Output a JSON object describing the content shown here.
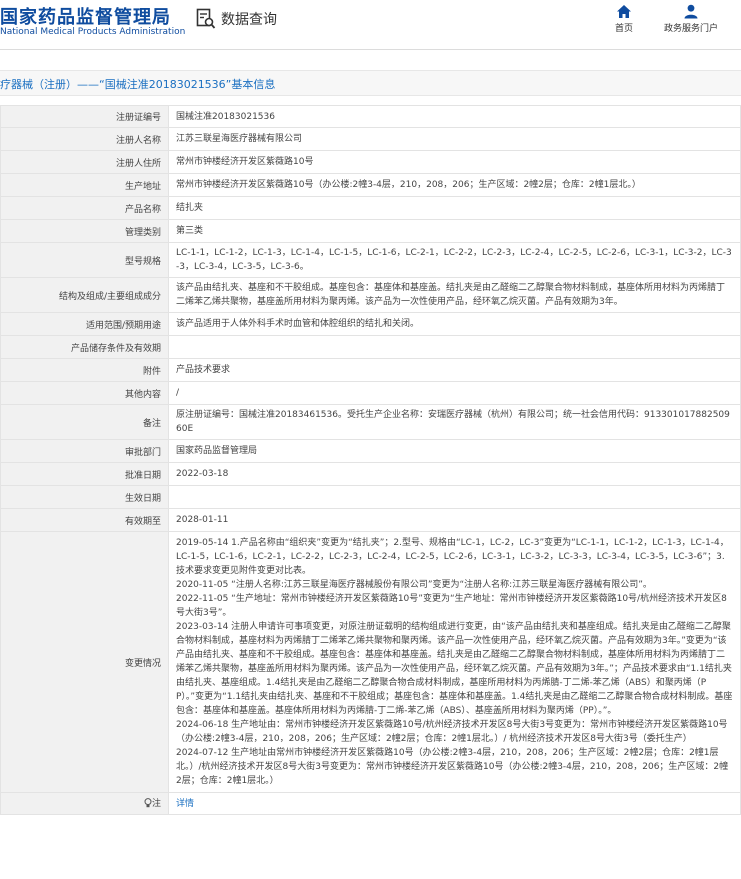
{
  "header": {
    "logo_cn": "国家药品监督管理局",
    "logo_en": "National Medical Products Administration",
    "search_label": "数据查询",
    "nav": [
      {
        "label": "首页",
        "icon": "home-icon"
      },
      {
        "label": "政务服务门户",
        "icon": "user-icon"
      }
    ]
  },
  "breadcrumb_title": "疗器械（注册）——“国械注准20183021536”基本信息",
  "rows": [
    {
      "label": "注册证编号",
      "value": "国械注准20183021536"
    },
    {
      "label": "注册人名称",
      "value": "江苏三联星海医疗器械有限公司"
    },
    {
      "label": "注册人住所",
      "value": "常州市钟楼经济开发区紫薇路10号"
    },
    {
      "label": "生产地址",
      "value": "常州市钟楼经济开发区紫薇路10号（办公楼:2幢3-4层，210，208，206；生产区域：2幢2层；仓库：2幢1层北。）"
    },
    {
      "label": "产品名称",
      "value": "结扎夹"
    },
    {
      "label": "管理类别",
      "value": "第三类"
    },
    {
      "label": "型号规格",
      "value": "LC-1-1，LC-1-2，LC-1-3，LC-1-4，LC-1-5，LC-1-6，LC-2-1，LC-2-2，LC-2-3，LC-2-4，LC-2-5，LC-2-6，LC-3-1，LC-3-2，LC-3-3，LC-3-4，LC-3-5，LC-3-6。"
    },
    {
      "label": "结构及组成/主要组成成分",
      "value": "该产品由结扎夹、基座和不干胶组成。基座包含：基座体和基座盖。结扎夹是由乙醛缩二乙醇聚合物材料制成，基座体所用材料为丙烯腈丁二烯苯乙烯共聚物，基座盖所用材料为聚丙烯。该产品为一次性使用产品，经环氧乙烷灭菌。产品有效期为3年。"
    },
    {
      "label": "适用范围/预期用途",
      "value": "该产品适用于人体外科手术时血管和体腔组织的结扎和关闭。"
    },
    {
      "label": "产品储存条件及有效期",
      "value": ""
    },
    {
      "label": "附件",
      "value": "产品技术要求"
    },
    {
      "label": "其他内容",
      "value": "/"
    },
    {
      "label": "备注",
      "value": "原注册证编号：国械注准20183461536。受托生产企业名称：安瑞医疗器械（杭州）有限公司；统一社会信用代码：91330101788250960E"
    },
    {
      "label": "审批部门",
      "value": "国家药品监督管理局"
    },
    {
      "label": "批准日期",
      "value": "2022-03-18"
    },
    {
      "label": "生效日期",
      "value": ""
    },
    {
      "label": "有效期至",
      "value": "2028-01-11"
    }
  ],
  "changes": {
    "label": "变更情况",
    "entries": [
      "2019-05-14 1.产品名称由“组织夹”变更为“结扎夹”；2.型号、规格由“LC-1，LC-2，LC-3”变更为“LC-1-1，LC-1-2，LC-1-3，LC-1-4，LC-1-5，LC-1-6，LC-2-1，LC-2-2，LC-2-3，LC-2-4，LC-2-5，LC-2-6，LC-3-1，LC-3-2，LC-3-3，LC-3-4，LC-3-5，LC-3-6”；3.技术要求变更见附件变更对比表。",
      "2020-11-05 “注册人名称:江苏三联星海医疗器械股份有限公司”变更为“注册人名称:江苏三联星海医疗器械有限公司”。",
      "2022-11-05 “生产地址：常州市钟楼经济开发区紫薇路10号”变更为“生产地址：常州市钟楼经济开发区紫薇路10号/杭州经济技术开发区8号大街3号”。",
      "2023-03-14 注册人申请许可事项变更，对原注册证载明的结构组成进行变更，由“该产品由结扎夹和基座组成。结扎夹是由乙醛缩二乙醇聚合物材料制成，基座材料为丙烯腈丁二烯苯乙烯共聚物和聚丙烯。该产品一次性使用产品，经环氧乙烷灭菌。产品有效期为3年。”变更为“该产品由结扎夹、基座和不干胶组成。基座包含：基座体和基座盖。结扎夹是由乙醛缩二乙醇聚合物材料制成，基座体所用材料为丙烯腈丁二烯苯乙烯共聚物，基座盖所用材料为聚丙烯。该产品为一次性使用产品，经环氧乙烷灭菌。产品有效期为3年。”；产品技术要求由“1.1结扎夹由结扎夹、基座组成。1.4结扎夹是由乙醛缩二乙醇聚合物合成材料制成，基座所用材料为丙烯腈-丁二烯-苯乙烯（ABS）和聚丙烯（PP）。”变更为“1.1结扎夹由结扎夹、基座和不干胶组成；基座包含：基座体和基座盖。1.4结扎夹是由乙醛缩二乙醇聚合物合成材料制成。基座包含：基座体和基座盖。基座体所用材料为丙烯腈-丁二烯-苯乙烯（ABS）、基座盖所用材料为聚丙烯（PP）。”。",
      "2024-06-18 生产地址由：常州市钟楼经济开发区紫薇路10号/杭州经济技术开发区8号大街3号变更为：常州市钟楼经济开发区紫薇路10号（办公楼:2幢3-4层，210，208，206；生产区域：2幢2层；仓库：2幢1层北。）/ 杭州经济技术开发区8号大街3号（委托生产）",
      "2024-07-12 生产地址由常州市钟楼经济开发区紫薇路10号（办公楼:2幢3-4层，210，208，206；生产区域：2幢2层；仓库：2幢1层北。）/杭州经济技术开发区8号大街3号变更为：常州市钟楼经济开发区紫薇路10号（办公楼:2幢3-4层，210，208，206；生产区域：2幢2层；仓库：2幢1层北。）"
    ]
  },
  "note": {
    "label": "注",
    "link": "详情"
  }
}
